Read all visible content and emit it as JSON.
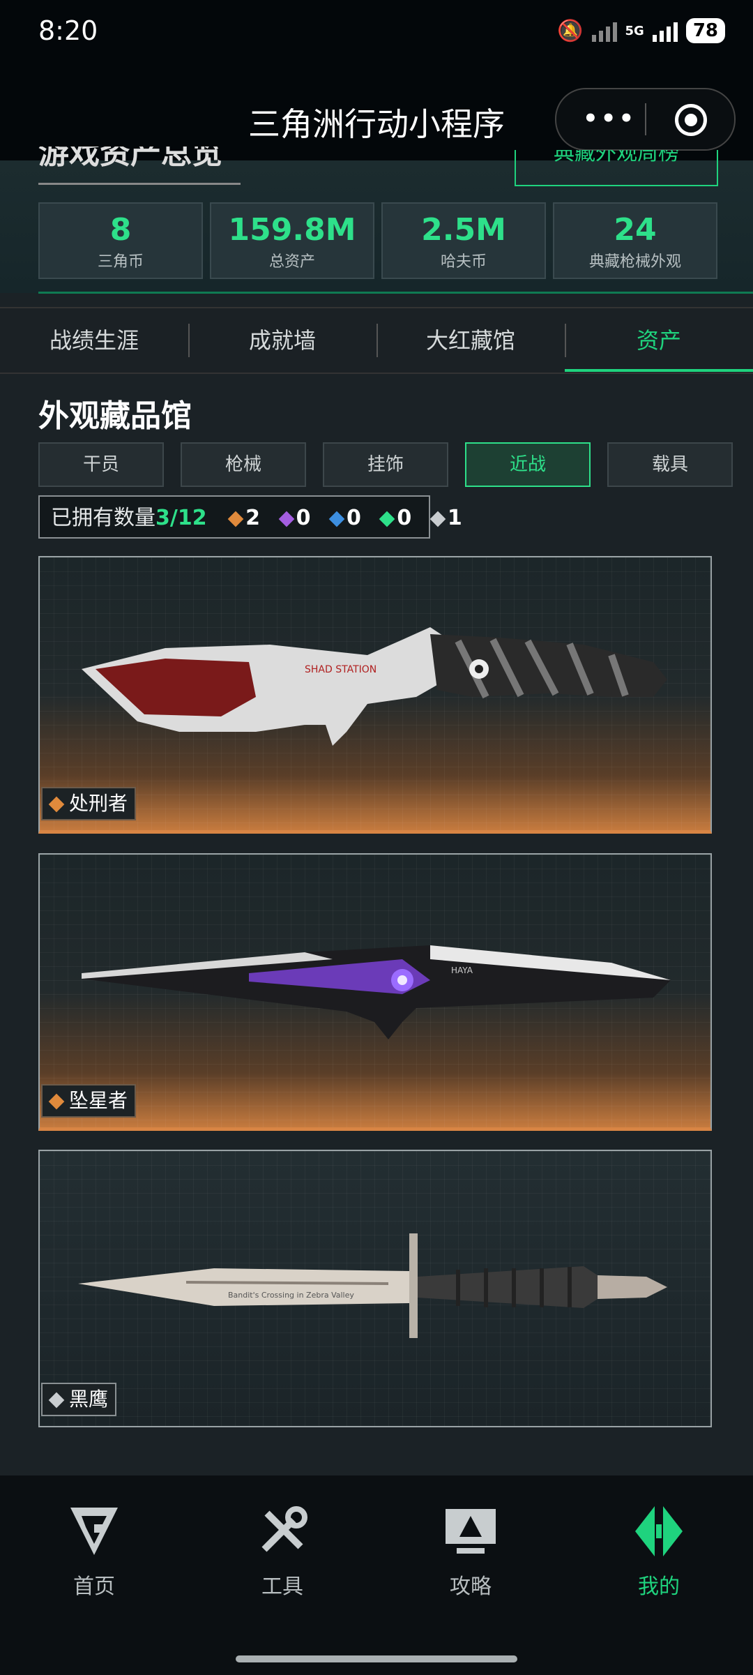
{
  "status_bar": {
    "time": "8:20",
    "network": "5G",
    "battery": "78"
  },
  "title_bar": {
    "title": "三角洲行动小程序",
    "more_label": "•••"
  },
  "header": {
    "overview_title": "游戏资产总览",
    "weekly_button": "典藏外观周榜"
  },
  "stats": [
    {
      "value": "8",
      "label": "三角币"
    },
    {
      "value": "159.8M",
      "label": "总资产"
    },
    {
      "value": "2.5M",
      "label": "哈夫币"
    },
    {
      "value": "24",
      "label": "典藏枪械外观"
    }
  ],
  "tabs": [
    {
      "label": "战绩生涯"
    },
    {
      "label": "成就墙"
    },
    {
      "label": "大红藏馆"
    },
    {
      "label": "资产",
      "active": true
    }
  ],
  "collection": {
    "title": "外观藏品馆",
    "filters": [
      {
        "label": "干员"
      },
      {
        "label": "枪械"
      },
      {
        "label": "挂饰"
      },
      {
        "label": "近战",
        "active": true
      },
      {
        "label": "载具"
      }
    ],
    "owned": {
      "label": "已拥有数量",
      "count": "3/12",
      "rarities": [
        {
          "count": "2",
          "color": "#e08a3c"
        },
        {
          "count": "0",
          "color": "#a45ee0"
        },
        {
          "count": "0",
          "color": "#3d8fe0"
        },
        {
          "count": "0",
          "color": "#2ee08a"
        },
        {
          "count": "1",
          "color": "#c9cdd0"
        }
      ]
    },
    "items": [
      {
        "name": "处刑者",
        "rarity_color": "#e08a3c",
        "knife_text": "SHAD STATION"
      },
      {
        "name": "坠星者",
        "rarity_color": "#e08a3c",
        "knife_text": "HAYA"
      },
      {
        "name": "黑鹰",
        "rarity_color": "#c9cdd0",
        "knife_text": "Bandit's Crossing in Zebra Valley"
      }
    ]
  },
  "bottom_nav": [
    {
      "label": "首页",
      "icon": "home-logo-icon"
    },
    {
      "label": "工具",
      "icon": "tools-icon"
    },
    {
      "label": "攻略",
      "icon": "guide-monitor-icon"
    },
    {
      "label": "我的",
      "icon": "profile-logo-icon",
      "active": true
    }
  ]
}
